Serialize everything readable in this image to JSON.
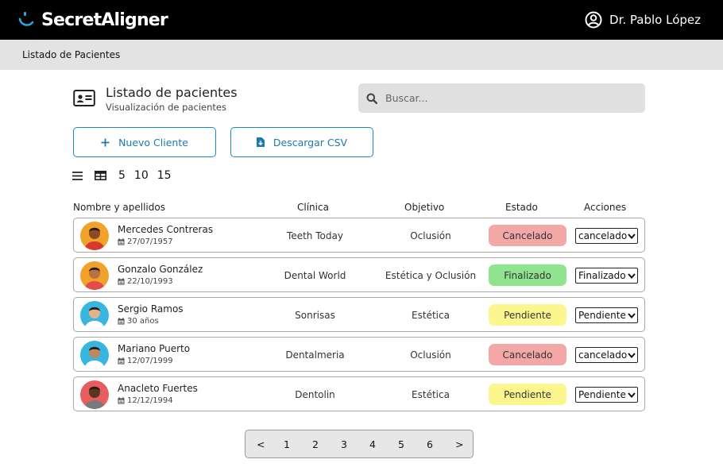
{
  "app": {
    "brand": "SecretAligner",
    "user_name": "Dr. Pablo López"
  },
  "breadcrumb": {
    "label": "Listado de Pacientes"
  },
  "page": {
    "title": "Listado de pacientes",
    "subtitle": "Visualización de pacientes"
  },
  "search": {
    "placeholder": "Buscar...",
    "value": ""
  },
  "actions": {
    "new_label": "Nuevo Cliente",
    "csv_label": "Descargar CSV"
  },
  "view": {
    "page_sizes": [
      "5",
      "10",
      "15"
    ]
  },
  "table": {
    "headers": {
      "name": "Nombre y apellidos",
      "clinic": "Clínica",
      "goal": "Objetivo",
      "status": "Estado",
      "actions": "Acciones"
    },
    "rows": [
      {
        "name": "Mercedes Contreras",
        "date": "27/07/1957",
        "clinic": "Teeth Today",
        "goal": "Oclusión",
        "status": "Cancelado",
        "status_color": "#f3a7a7",
        "select": "cancelado"
      },
      {
        "name": "Gonzalo González",
        "date": "22/10/1993",
        "clinic": "Dental World",
        "goal": "Estética y Oclusión",
        "status": "Finalizado",
        "status_color": "#90e38f",
        "select": "Finalizado"
      },
      {
        "name": "Sergio Ramos",
        "date": "30 años",
        "clinic": "Sonrisas",
        "goal": "Estética",
        "status": "Pendiente",
        "status_color": "#fbf78e",
        "select": "Pendiente"
      },
      {
        "name": "Mariano Puerto",
        "date": "12/07/1999",
        "clinic": "Dentalmeria",
        "goal": "Oclusión",
        "status": "Cancelado",
        "status_color": "#f3a7a7",
        "select": "cancelado"
      },
      {
        "name": "Anacleto Fuertes",
        "date": "12/12/1994",
        "clinic": "Dentolin",
        "goal": "Estética",
        "status": "Pendiente",
        "status_color": "#fbf78e",
        "select": "Pendiente"
      }
    ]
  },
  "pagination": {
    "prev": "<",
    "pages": [
      "1",
      "2",
      "3",
      "4",
      "5",
      "6"
    ],
    "next": ">"
  },
  "colors": {
    "accent": "#1b8bbd",
    "topbar": "#000000",
    "logo_accent": "#29a9e1"
  }
}
